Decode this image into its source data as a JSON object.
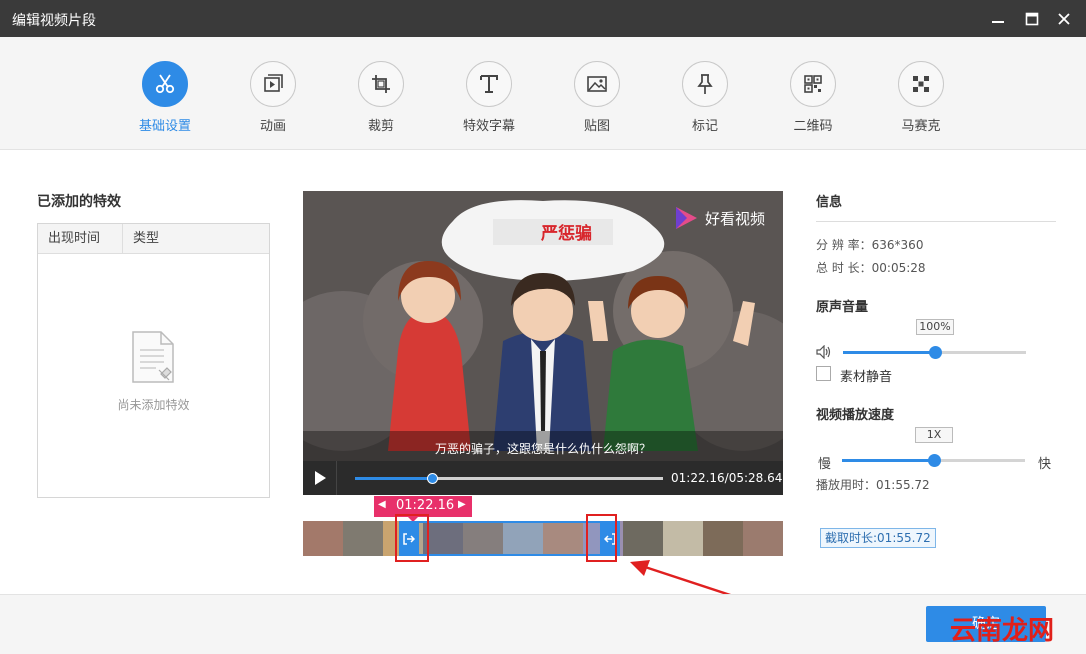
{
  "window": {
    "title": "编辑视频片段"
  },
  "tools": [
    {
      "label": "基础设置",
      "icon": "scissors-icon",
      "active": true
    },
    {
      "label": "动画",
      "icon": "animation-icon"
    },
    {
      "label": "裁剪",
      "icon": "crop-icon"
    },
    {
      "label": "特效字幕",
      "icon": "text-icon"
    },
    {
      "label": "贴图",
      "icon": "image-icon"
    },
    {
      "label": "标记",
      "icon": "pin-icon"
    },
    {
      "label": "二维码",
      "icon": "qrcode-icon"
    },
    {
      "label": "马赛克",
      "icon": "mosaic-icon"
    }
  ],
  "effects": {
    "title": "已添加的特效",
    "columns": [
      "出现时间",
      "类型"
    ],
    "empty_text": "尚未添加特效"
  },
  "video": {
    "watermark": "好看视频",
    "banner_text": "严惩骗",
    "subtitle": "万恶的骗子，这跟您是什么仇什么怨啊？",
    "time_display": "01:22.16/05:28.64",
    "progress": 0.25
  },
  "trim": {
    "start_time": "01:22.16",
    "start_fraction": 0.22,
    "end_fraction": 0.64
  },
  "info": {
    "title": "信息",
    "resolution_label": "分 辨 率：",
    "resolution_value": "636*360",
    "duration_label": "总 时 长：",
    "duration_value": "00:05:28"
  },
  "volume": {
    "title": "原声音量",
    "value_label": "100%",
    "level": 0.5,
    "mute_label": "素材静音"
  },
  "speed": {
    "title": "视频播放速度",
    "value_label": "1X",
    "level": 0.5,
    "slow_label": "慢",
    "fast_label": "快",
    "play_time_label": "播放用时：",
    "play_time_value": "01:55.72"
  },
  "clip_duration": "截取时长:01:55.72",
  "confirm_button": "确定",
  "watermark_site": "云南龙网",
  "colors": {
    "accent": "#2e8be6",
    "trim": "#e8306a",
    "title_bar": "#3a3a3a"
  }
}
